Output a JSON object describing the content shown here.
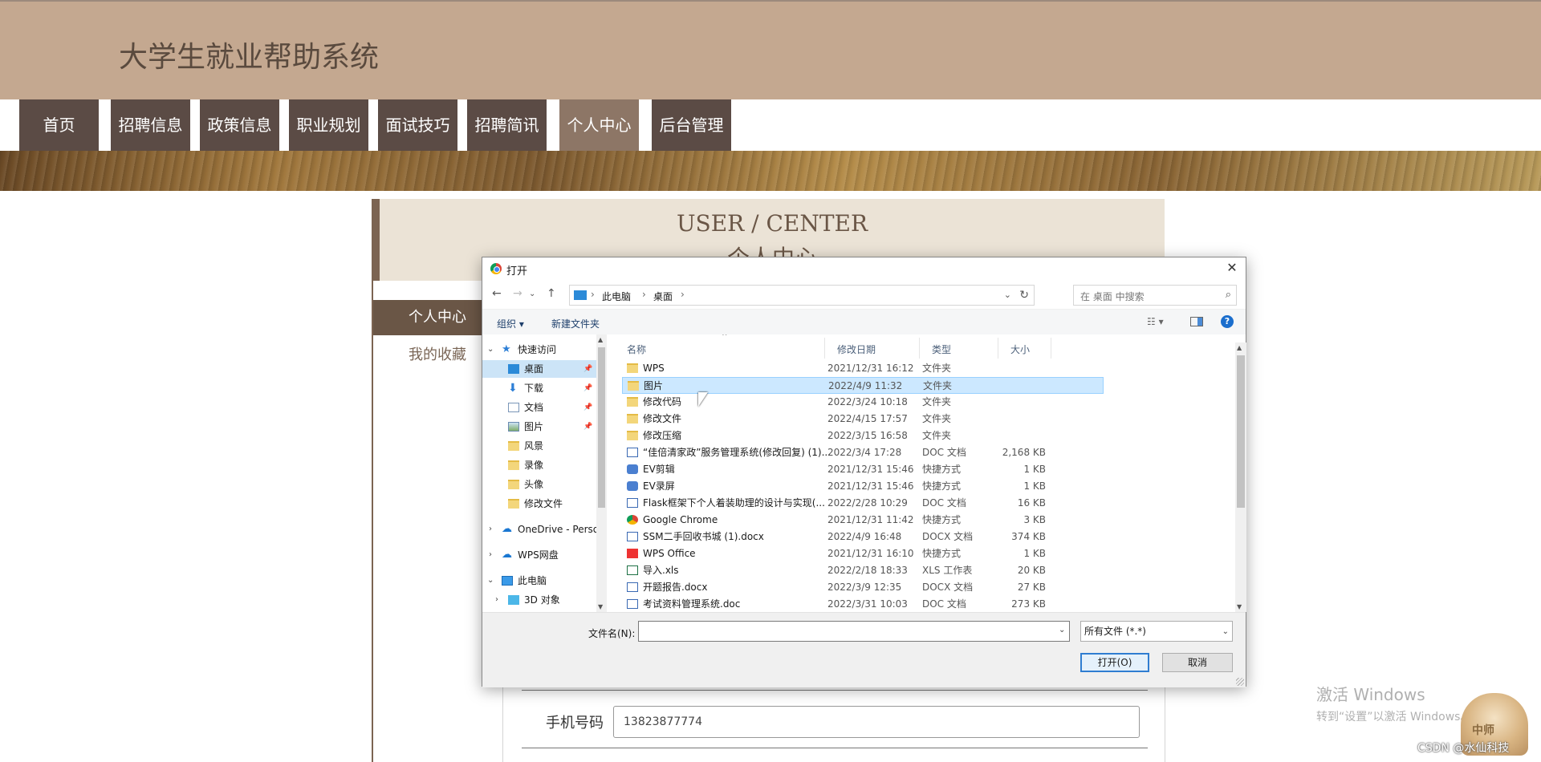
{
  "site": {
    "title": "大学生就业帮助系统"
  },
  "nav": {
    "items": [
      "首页",
      "招聘信息",
      "政策信息",
      "职业规划",
      "面试技巧",
      "招聘简讯",
      "个人中心",
      "后台管理"
    ],
    "active": "个人中心"
  },
  "panel": {
    "title_en": "USER / CENTER",
    "title_cn": "个人中心"
  },
  "sidebar": {
    "title": "个人中心",
    "items": [
      "我的收藏"
    ]
  },
  "form": {
    "phone_label": "手机号码",
    "phone_value": "13823877774"
  },
  "dialog": {
    "title": "打开",
    "close_glyph": "✕",
    "address": {
      "segments": [
        "此电脑",
        "桌面"
      ]
    },
    "search_placeholder": "在 桌面 中搜索",
    "toolbar": {
      "organize": "组织 ▾",
      "new_folder": "新建文件夹",
      "help": "?"
    },
    "nav_tree": [
      {
        "label": "快速访问",
        "icon": "star-icon"
      },
      {
        "label": "桌面",
        "icon": "desktop-icon",
        "selected": true,
        "pinned": true
      },
      {
        "label": "下载",
        "icon": "download-icon",
        "pinned": true
      },
      {
        "label": "文档",
        "icon": "document-icon",
        "pinned": true
      },
      {
        "label": "图片",
        "icon": "pictures-icon",
        "pinned": true
      },
      {
        "label": "风景",
        "icon": "folder-icon"
      },
      {
        "label": "录像",
        "icon": "folder-icon"
      },
      {
        "label": "头像",
        "icon": "folder-icon"
      },
      {
        "label": "修改文件",
        "icon": "folder-icon"
      },
      {
        "label": "OneDrive - Personal",
        "icon": "onedrive-icon"
      },
      {
        "label": "WPS网盘",
        "icon": "cloud-icon"
      },
      {
        "label": "此电脑",
        "icon": "pc-icon"
      },
      {
        "label": "3D 对象",
        "icon": "3d-objects-icon"
      }
    ],
    "columns": {
      "name": "名称",
      "modified": "修改日期",
      "type": "类型",
      "size": "大小"
    },
    "files": [
      {
        "name": "WPS",
        "modified": "2021/12/31 16:12",
        "type": "文件夹",
        "size": "",
        "icon": "folder"
      },
      {
        "name": "图片",
        "modified": "2022/4/9 11:32",
        "type": "文件夹",
        "size": "",
        "icon": "folder",
        "selected": true
      },
      {
        "name": "修改代码",
        "modified": "2022/3/24 10:18",
        "type": "文件夹",
        "size": "",
        "icon": "folder"
      },
      {
        "name": "修改文件",
        "modified": "2022/4/15 17:57",
        "type": "文件夹",
        "size": "",
        "icon": "folder"
      },
      {
        "name": "修改压缩",
        "modified": "2022/3/15 16:58",
        "type": "文件夹",
        "size": "",
        "icon": "folder"
      },
      {
        "name": "“佳倍清家政”服务管理系统(修改回复) (1)...",
        "modified": "2022/3/4 17:28",
        "type": "DOC 文档",
        "size": "2,168 KB",
        "icon": "doc"
      },
      {
        "name": "EV剪辑",
        "modified": "2021/12/31 15:46",
        "type": "快捷方式",
        "size": "1 KB",
        "icon": "link"
      },
      {
        "name": "EV录屏",
        "modified": "2021/12/31 15:46",
        "type": "快捷方式",
        "size": "1 KB",
        "icon": "link"
      },
      {
        "name": "Flask框架下个人着装助理的设计与实现(...",
        "modified": "2022/2/28 10:29",
        "type": "DOC 文档",
        "size": "16 KB",
        "icon": "doc"
      },
      {
        "name": "Google Chrome",
        "modified": "2021/12/31 11:42",
        "type": "快捷方式",
        "size": "3 KB",
        "icon": "chrome"
      },
      {
        "name": "SSM二手回收书城 (1).docx",
        "modified": "2022/4/9 16:48",
        "type": "DOCX 文档",
        "size": "374 KB",
        "icon": "doc"
      },
      {
        "name": "WPS Office",
        "modified": "2021/12/31 16:10",
        "type": "快捷方式",
        "size": "1 KB",
        "icon": "wps"
      },
      {
        "name": "导入.xls",
        "modified": "2022/2/18 18:33",
        "type": "XLS 工作表",
        "size": "20 KB",
        "icon": "xls"
      },
      {
        "name": "开题报告.docx",
        "modified": "2022/3/9 12:35",
        "type": "DOCX 文档",
        "size": "27 KB",
        "icon": "doc"
      },
      {
        "name": "考试资料管理系统.doc",
        "modified": "2022/3/31 10:03",
        "type": "DOC 文档",
        "size": "273 KB",
        "icon": "doc"
      }
    ],
    "filename_label": "文件名(N):",
    "filename_value": "",
    "filetype_value": "所有文件 (*.*)",
    "open_label": "打开(O)",
    "cancel_label": "取消"
  },
  "watermark": {
    "activate_title": "激活 Windows",
    "activate_sub": "转到“设置”以激活 Windows。",
    "csdn": "CSDN @水仙科技",
    "mascot_label": "中师"
  },
  "colors": {
    "header_bg": "#c4a890",
    "nav_bg": "#5b4b45",
    "nav_active": "#8d7666",
    "accent": "#6a5646"
  }
}
